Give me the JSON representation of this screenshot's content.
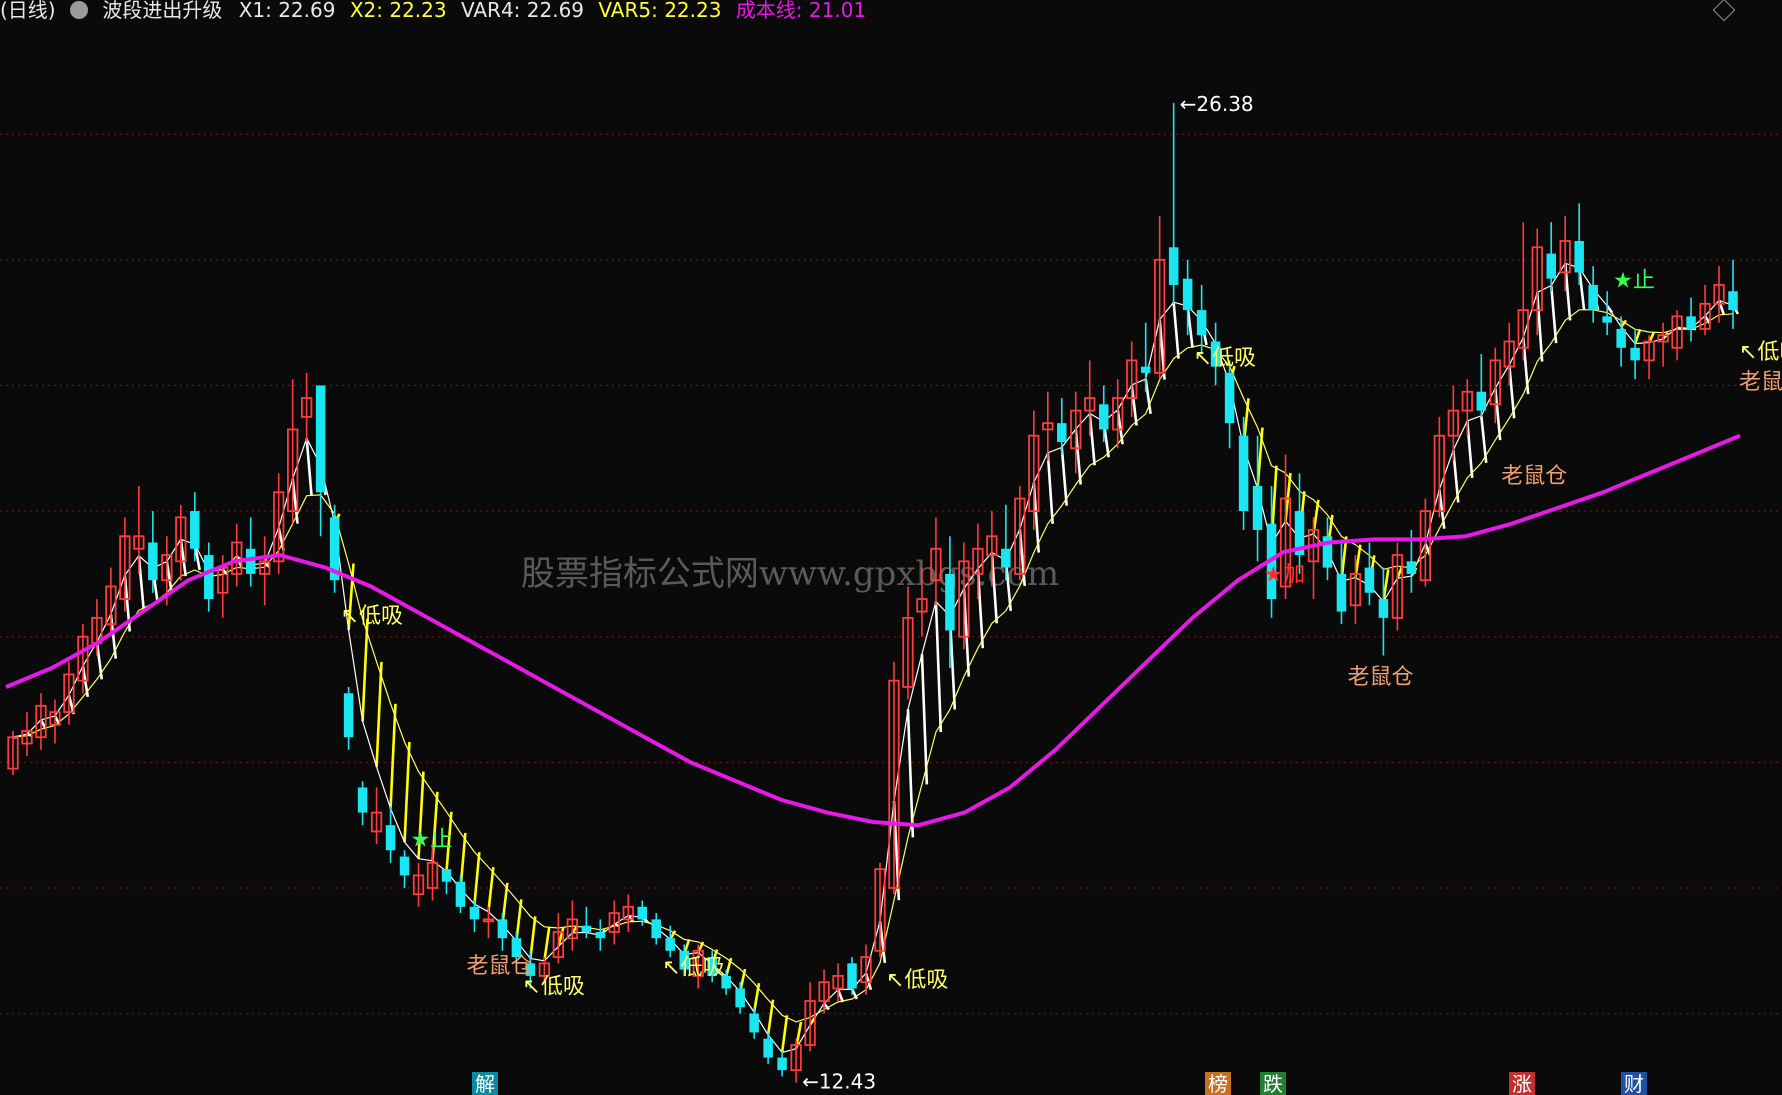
{
  "header": {
    "period": "(日线)",
    "indicator_name": "波段进出升级",
    "x1": "X1: 22.69",
    "x2": "X2: 22.23",
    "var4": "VAR4: 22.69",
    "var5": "VAR5: 22.23",
    "cost_line": "成本线: 21.01"
  },
  "watermark": "股票指标公式网www.gpxbgs.com",
  "colors": {
    "background": "#0a0a0a",
    "bull_candle": "#ff3b3b",
    "bear_candle": "#19e6f0",
    "cost_line": "#e619e6",
    "up_band": "#ffffff",
    "down_band": "#ffff00",
    "signal_text": "#ffff66",
    "rat_text": "#f0a070",
    "grid": "#8a1010"
  },
  "chart_data": {
    "type": "candlestick",
    "timeframe": "daily",
    "ylim": [
      11.5,
      27.5
    ],
    "grid": "horizontal dotted",
    "high_label": "26.38",
    "low_label": "12.43",
    "candles": [
      {
        "o": 15.9,
        "h": 16.5,
        "l": 15.8,
        "c": 16.4
      },
      {
        "o": 16.3,
        "h": 16.8,
        "l": 16.1,
        "c": 16.5
      },
      {
        "o": 16.4,
        "h": 17.1,
        "l": 16.2,
        "c": 16.9
      },
      {
        "o": 16.6,
        "h": 17.0,
        "l": 16.3,
        "c": 16.8
      },
      {
        "o": 16.8,
        "h": 17.6,
        "l": 16.6,
        "c": 17.4
      },
      {
        "o": 17.3,
        "h": 18.2,
        "l": 17.1,
        "c": 18.0
      },
      {
        "o": 17.9,
        "h": 18.6,
        "l": 17.7,
        "c": 18.3
      },
      {
        "o": 18.2,
        "h": 19.1,
        "l": 18.0,
        "c": 18.8
      },
      {
        "o": 18.6,
        "h": 19.9,
        "l": 18.4,
        "c": 19.6
      },
      {
        "o": 19.4,
        "h": 20.4,
        "l": 19.0,
        "c": 19.6
      },
      {
        "o": 19.5,
        "h": 20.0,
        "l": 18.7,
        "c": 18.9
      },
      {
        "o": 18.9,
        "h": 19.6,
        "l": 18.5,
        "c": 19.3
      },
      {
        "o": 19.2,
        "h": 20.1,
        "l": 18.9,
        "c": 19.9
      },
      {
        "o": 20.0,
        "h": 20.3,
        "l": 19.2,
        "c": 19.4
      },
      {
        "o": 19.3,
        "h": 19.5,
        "l": 18.4,
        "c": 18.6
      },
      {
        "o": 18.7,
        "h": 19.3,
        "l": 18.3,
        "c": 19.1
      },
      {
        "o": 19.0,
        "h": 19.8,
        "l": 18.8,
        "c": 19.5
      },
      {
        "o": 19.4,
        "h": 19.9,
        "l": 18.8,
        "c": 19.0
      },
      {
        "o": 19.0,
        "h": 19.6,
        "l": 18.5,
        "c": 19.2
      },
      {
        "o": 19.2,
        "h": 20.6,
        "l": 19.0,
        "c": 20.3
      },
      {
        "o": 20.0,
        "h": 22.1,
        "l": 19.8,
        "c": 21.3
      },
      {
        "o": 21.5,
        "h": 22.2,
        "l": 21.1,
        "c": 21.8
      },
      {
        "o": 22.0,
        "h": 22.0,
        "l": 19.6,
        "c": 20.3
      },
      {
        "o": 19.9,
        "h": 20.1,
        "l": 18.7,
        "c": 18.9
      },
      {
        "o": 17.1,
        "h": 17.2,
        "l": 16.2,
        "c": 16.4
      },
      {
        "o": 15.6,
        "h": 15.7,
        "l": 15.0,
        "c": 15.2
      },
      {
        "o": 14.9,
        "h": 15.6,
        "l": 14.7,
        "c": 15.2
      },
      {
        "o": 15.0,
        "h": 15.3,
        "l": 14.4,
        "c": 14.6
      },
      {
        "o": 14.5,
        "h": 14.6,
        "l": 14.0,
        "c": 14.2
      },
      {
        "o": 13.9,
        "h": 14.4,
        "l": 13.7,
        "c": 14.2
      },
      {
        "o": 14.0,
        "h": 14.7,
        "l": 13.8,
        "c": 14.4
      },
      {
        "o": 14.3,
        "h": 14.3,
        "l": 13.9,
        "c": 14.1
      },
      {
        "o": 14.1,
        "h": 14.2,
        "l": 13.6,
        "c": 13.7
      },
      {
        "o": 13.7,
        "h": 13.8,
        "l": 13.3,
        "c": 13.5
      },
      {
        "o": 13.5,
        "h": 13.7,
        "l": 13.2,
        "c": 13.5
      },
      {
        "o": 13.5,
        "h": 13.6,
        "l": 13.0,
        "c": 13.2
      },
      {
        "o": 13.2,
        "h": 13.3,
        "l": 12.8,
        "c": 12.9
      },
      {
        "o": 12.8,
        "h": 13.0,
        "l": 12.4,
        "c": 12.6
      },
      {
        "o": 12.6,
        "h": 12.9,
        "l": 12.5,
        "c": 12.8
      },
      {
        "o": 12.9,
        "h": 13.6,
        "l": 12.8,
        "c": 13.3
      },
      {
        "o": 13.2,
        "h": 13.8,
        "l": 13.0,
        "c": 13.5
      },
      {
        "o": 13.4,
        "h": 13.7,
        "l": 13.2,
        "c": 13.3
      },
      {
        "o": 13.3,
        "h": 13.5,
        "l": 13.0,
        "c": 13.2
      },
      {
        "o": 13.3,
        "h": 13.8,
        "l": 13.1,
        "c": 13.6
      },
      {
        "o": 13.5,
        "h": 13.9,
        "l": 13.3,
        "c": 13.7
      },
      {
        "o": 13.7,
        "h": 13.8,
        "l": 13.4,
        "c": 13.5
      },
      {
        "o": 13.5,
        "h": 13.6,
        "l": 13.1,
        "c": 13.2
      },
      {
        "o": 13.2,
        "h": 13.4,
        "l": 12.9,
        "c": 13.0
      },
      {
        "o": 13.0,
        "h": 13.1,
        "l": 12.6,
        "c": 12.7
      },
      {
        "o": 12.6,
        "h": 13.1,
        "l": 12.4,
        "c": 13.0
      },
      {
        "o": 12.9,
        "h": 13.0,
        "l": 12.5,
        "c": 12.6
      },
      {
        "o": 12.6,
        "h": 12.7,
        "l": 12.3,
        "c": 12.4
      },
      {
        "o": 12.4,
        "h": 12.5,
        "l": 12.0,
        "c": 12.1
      },
      {
        "o": 12.0,
        "h": 12.1,
        "l": 11.6,
        "c": 11.7
      },
      {
        "o": 11.6,
        "h": 11.7,
        "l": 11.2,
        "c": 11.3
      },
      {
        "o": 11.3,
        "h": 11.4,
        "l": 11.0,
        "c": 11.1
      },
      {
        "o": 11.1,
        "h": 11.6,
        "l": 10.9,
        "c": 11.5
      },
      {
        "o": 11.5,
        "h": 12.5,
        "l": 11.4,
        "c": 12.2
      },
      {
        "o": 12.2,
        "h": 12.7,
        "l": 12.0,
        "c": 12.5
      },
      {
        "o": 12.4,
        "h": 12.8,
        "l": 12.2,
        "c": 12.6
      },
      {
        "o": 12.8,
        "h": 12.9,
        "l": 12.3,
        "c": 12.4
      },
      {
        "o": 12.5,
        "h": 13.1,
        "l": 12.3,
        "c": 12.9
      },
      {
        "o": 13.0,
        "h": 14.4,
        "l": 12.9,
        "c": 14.3
      },
      {
        "o": 14.0,
        "h": 17.6,
        "l": 13.9,
        "c": 17.3
      },
      {
        "o": 17.2,
        "h": 18.8,
        "l": 17.0,
        "c": 18.3
      },
      {
        "o": 18.4,
        "h": 19.1,
        "l": 18.0,
        "c": 18.6
      },
      {
        "o": 18.9,
        "h": 19.9,
        "l": 18.5,
        "c": 19.4
      },
      {
        "o": 19.0,
        "h": 19.6,
        "l": 17.5,
        "c": 18.1
      },
      {
        "o": 18.0,
        "h": 19.5,
        "l": 17.8,
        "c": 19.2
      },
      {
        "o": 19.0,
        "h": 19.8,
        "l": 18.6,
        "c": 19.4
      },
      {
        "o": 19.3,
        "h": 20.0,
        "l": 18.8,
        "c": 19.6
      },
      {
        "o": 19.4,
        "h": 20.1,
        "l": 18.9,
        "c": 19.1
      },
      {
        "o": 19.0,
        "h": 20.4,
        "l": 18.9,
        "c": 20.2
      },
      {
        "o": 20.0,
        "h": 21.6,
        "l": 19.7,
        "c": 21.2
      },
      {
        "o": 21.3,
        "h": 21.9,
        "l": 20.8,
        "c": 21.4
      },
      {
        "o": 21.4,
        "h": 21.8,
        "l": 20.9,
        "c": 21.1
      },
      {
        "o": 21.0,
        "h": 21.9,
        "l": 20.6,
        "c": 21.6
      },
      {
        "o": 21.6,
        "h": 22.4,
        "l": 21.2,
        "c": 21.8
      },
      {
        "o": 21.7,
        "h": 22.0,
        "l": 21.1,
        "c": 21.3
      },
      {
        "o": 21.3,
        "h": 22.1,
        "l": 21.0,
        "c": 21.8
      },
      {
        "o": 21.8,
        "h": 22.7,
        "l": 21.5,
        "c": 22.4
      },
      {
        "o": 22.3,
        "h": 23.0,
        "l": 21.9,
        "c": 22.2
      },
      {
        "o": 22.2,
        "h": 24.7,
        "l": 22.1,
        "c": 24.0
      },
      {
        "o": 24.2,
        "h": 26.5,
        "l": 23.3,
        "c": 23.6
      },
      {
        "o": 23.7,
        "h": 24.0,
        "l": 22.8,
        "c": 23.2
      },
      {
        "o": 23.2,
        "h": 23.6,
        "l": 22.5,
        "c": 22.8
      },
      {
        "o": 22.7,
        "h": 23.0,
        "l": 22.0,
        "c": 22.3
      },
      {
        "o": 22.2,
        "h": 22.4,
        "l": 21.0,
        "c": 21.4
      },
      {
        "o": 21.2,
        "h": 21.5,
        "l": 19.7,
        "c": 20.0
      },
      {
        "o": 20.4,
        "h": 21.2,
        "l": 19.2,
        "c": 19.7
      },
      {
        "o": 19.8,
        "h": 20.4,
        "l": 18.3,
        "c": 18.6
      },
      {
        "o": 18.8,
        "h": 20.9,
        "l": 18.6,
        "c": 20.2
      },
      {
        "o": 20.0,
        "h": 20.6,
        "l": 19.0,
        "c": 19.3
      },
      {
        "o": 19.2,
        "h": 19.9,
        "l": 18.6,
        "c": 19.7
      },
      {
        "o": 19.6,
        "h": 19.9,
        "l": 18.9,
        "c": 19.1
      },
      {
        "o": 19.0,
        "h": 19.5,
        "l": 18.2,
        "c": 18.4
      },
      {
        "o": 18.5,
        "h": 19.3,
        "l": 18.2,
        "c": 19.0
      },
      {
        "o": 19.1,
        "h": 19.5,
        "l": 18.5,
        "c": 18.7
      },
      {
        "o": 18.6,
        "h": 19.1,
        "l": 17.7,
        "c": 18.3
      },
      {
        "o": 18.3,
        "h": 19.5,
        "l": 18.1,
        "c": 19.3
      },
      {
        "o": 19.2,
        "h": 19.7,
        "l": 18.7,
        "c": 19.0
      },
      {
        "o": 18.9,
        "h": 20.2,
        "l": 18.8,
        "c": 20.0
      },
      {
        "o": 20.0,
        "h": 21.5,
        "l": 19.9,
        "c": 21.2
      },
      {
        "o": 21.2,
        "h": 22.0,
        "l": 20.8,
        "c": 21.6
      },
      {
        "o": 21.6,
        "h": 22.1,
        "l": 21.2,
        "c": 21.9
      },
      {
        "o": 21.9,
        "h": 22.5,
        "l": 21.5,
        "c": 21.6
      },
      {
        "o": 21.7,
        "h": 22.6,
        "l": 21.4,
        "c": 22.4
      },
      {
        "o": 22.3,
        "h": 23.0,
        "l": 22.0,
        "c": 22.7
      },
      {
        "o": 22.6,
        "h": 24.6,
        "l": 22.4,
        "c": 23.2
      },
      {
        "o": 23.2,
        "h": 24.5,
        "l": 22.8,
        "c": 24.2
      },
      {
        "o": 24.1,
        "h": 24.6,
        "l": 23.5,
        "c": 23.7
      },
      {
        "o": 23.8,
        "h": 24.7,
        "l": 23.5,
        "c": 24.3
      },
      {
        "o": 24.3,
        "h": 24.9,
        "l": 23.6,
        "c": 23.8
      },
      {
        "o": 23.6,
        "h": 23.9,
        "l": 23.0,
        "c": 23.2
      },
      {
        "o": 23.1,
        "h": 23.5,
        "l": 22.8,
        "c": 23.0
      },
      {
        "o": 22.9,
        "h": 23.1,
        "l": 22.3,
        "c": 22.6
      },
      {
        "o": 22.6,
        "h": 22.9,
        "l": 22.1,
        "c": 22.4
      },
      {
        "o": 22.4,
        "h": 22.8,
        "l": 22.1,
        "c": 22.7
      },
      {
        "o": 22.7,
        "h": 23.0,
        "l": 22.3,
        "c": 22.8
      },
      {
        "o": 22.6,
        "h": 23.2,
        "l": 22.4,
        "c": 23.1
      },
      {
        "o": 23.1,
        "h": 23.4,
        "l": 22.7,
        "c": 22.9
      },
      {
        "o": 22.9,
        "h": 23.6,
        "l": 22.8,
        "c": 23.3
      },
      {
        "o": 23.3,
        "h": 23.9,
        "l": 23.0,
        "c": 23.6
      },
      {
        "o": 23.5,
        "h": 24.0,
        "l": 22.9,
        "c": 23.2
      }
    ],
    "series": [
      {
        "name": "成本线",
        "values": [
          17.2,
          17.5,
          17.9,
          18.4,
          18.9,
          19.2,
          19.3,
          19.1,
          18.8,
          18.4,
          18.0,
          17.6,
          17.2,
          16.8,
          16.4,
          16.0,
          15.7,
          15.4,
          15.2,
          15.05,
          15.0,
          15.2,
          15.6,
          16.2,
          16.9,
          17.6,
          18.3,
          18.9,
          19.35,
          19.5,
          19.55,
          19.55,
          19.6,
          19.8,
          20.05,
          20.3,
          20.6,
          20.9,
          21.2
        ]
      }
    ],
    "signals": [
      {
        "label": "低吸",
        "bar": 23
      },
      {
        "label": "止",
        "bar": 28
      },
      {
        "label": "老鼠仓",
        "bar": 32
      },
      {
        "label": "低吸",
        "bar": 36
      },
      {
        "label": "低吸",
        "bar": 46
      },
      {
        "label": "低吸",
        "bar": 62
      },
      {
        "label": "低吸",
        "bar": 84
      },
      {
        "label": "加",
        "bar": 89
      },
      {
        "label": "老鼠仓",
        "bar": 95
      },
      {
        "label": "老鼠仓",
        "bar": 106
      },
      {
        "label": "止",
        "bar": 114
      },
      {
        "label": "低吸",
        "bar": 123
      },
      {
        "label": "老鼠仓",
        "bar": 123
      },
      {
        "label": "低吸",
        "bar": 132
      },
      {
        "label": "加",
        "bar": 134
      },
      {
        "label": "低吸",
        "bar": 149
      }
    ]
  },
  "bottom_markers": [
    {
      "label": "解",
      "color": "#0a8aa0"
    },
    {
      "label": "榜",
      "color": "#c87020"
    },
    {
      "label": "跌",
      "color": "#208030"
    },
    {
      "label": "涨",
      "color": "#c03030"
    },
    {
      "label": "财",
      "color": "#2050a0"
    }
  ]
}
